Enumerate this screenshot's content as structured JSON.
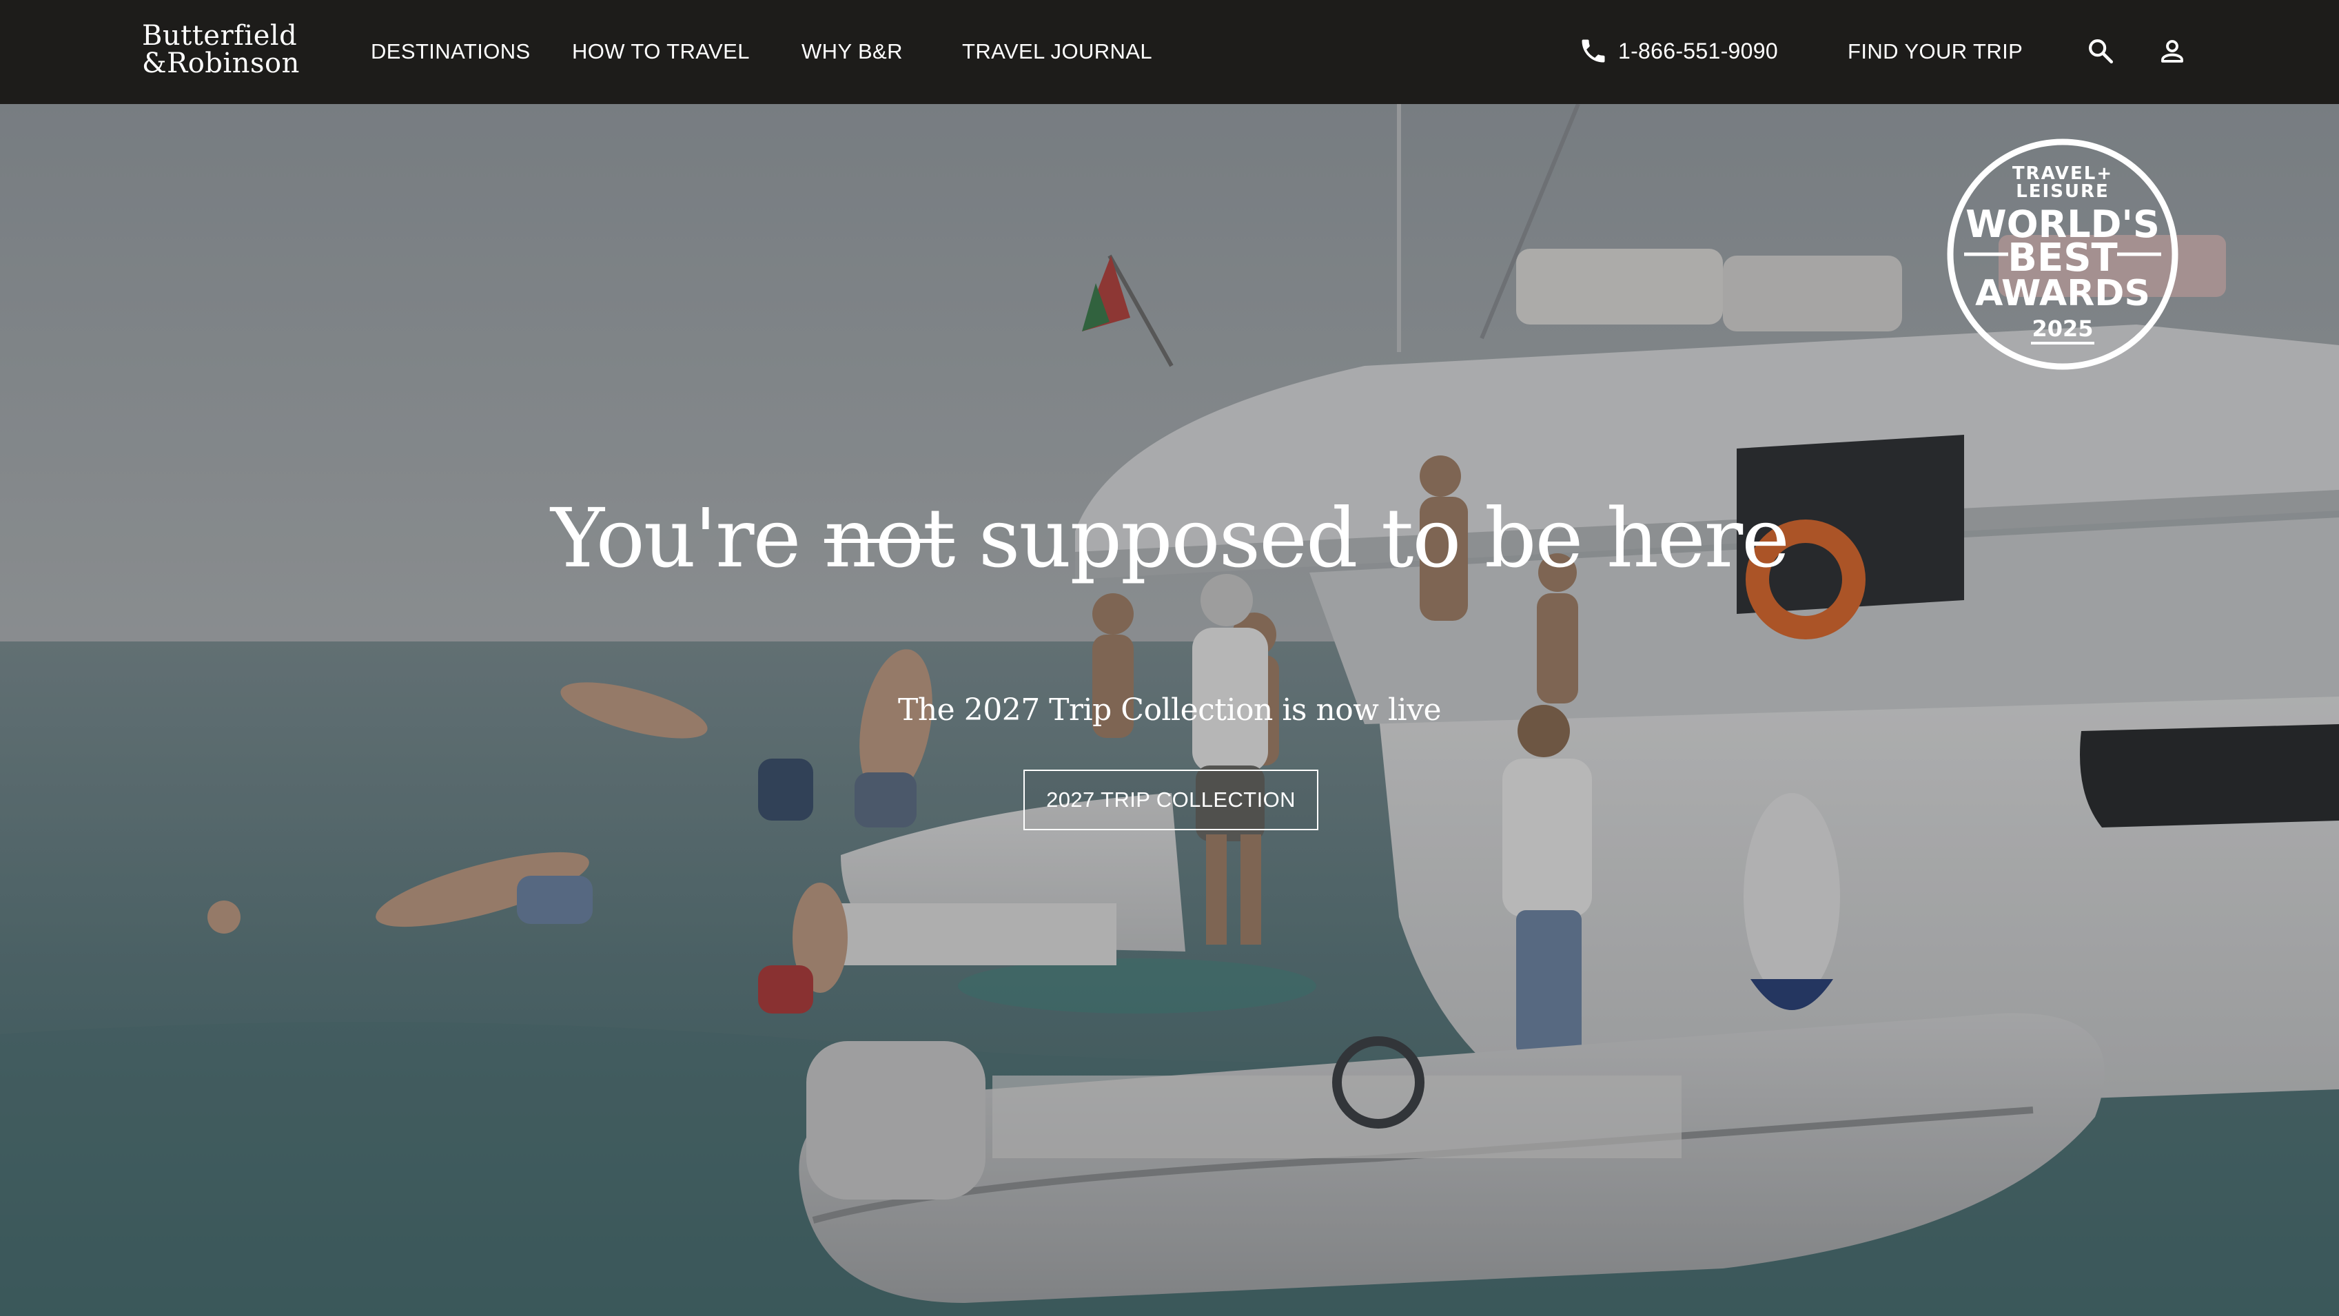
{
  "brand": {
    "logo_line1": "Butterfield",
    "logo_line2": "&Robinson"
  },
  "nav": {
    "items": [
      {
        "label": "DESTINATIONS"
      },
      {
        "label": "HOW TO TRAVEL"
      },
      {
        "label": "WHY B&R"
      },
      {
        "label": "TRAVEL JOURNAL"
      }
    ],
    "phone": "1-866-551-9090",
    "find_trip": "FIND YOUR TRIP",
    "icons": [
      "phone-icon",
      "search-icon",
      "account-icon"
    ]
  },
  "hero": {
    "headline_pre": "You're ",
    "headline_struck": "not",
    "headline_post": " supposed to be here",
    "subhead": "The 2027 Trip Collection is now live",
    "cta_label": "2027 TRIP COLLECTION",
    "award": {
      "line1": "TRAVEL+",
      "line2": "LEISURE",
      "line3": "WORLD'S",
      "line4": "BEST",
      "line5": "AWARDS",
      "year": "2025"
    }
  },
  "colors": {
    "nav_bg": "#1d1c1a",
    "text": "#ffffff",
    "sea": "#5f7a80",
    "sky": "#8b939a"
  }
}
